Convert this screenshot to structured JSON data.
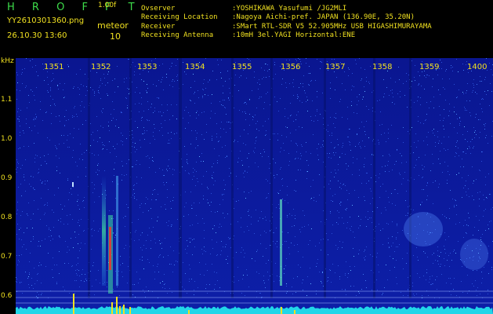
{
  "header": {
    "brand": "H R O F F T",
    "version": "1.00f",
    "filename": "YY2610301360.png",
    "meteor_label": "meteor",
    "timestamp": "26.10.30 13:60",
    "meteor_count": "10",
    "info": [
      {
        "key": "Ovserver",
        "value": ":YOSHIKAWA Yasufumi /JG2MLI"
      },
      {
        "key": "Receiving Location",
        "value": ":Nagoya Aichi-pref. JAPAN (136.90E, 35.20N)"
      },
      {
        "key": "Receiver",
        "value": ":SMart RTL-SDR V5 52.905MHz USB HIGASHIMURAYAMA"
      },
      {
        "key": "Receiving Antenna",
        "value": ":10mH 3el.YAGI Horizontal:ENE"
      }
    ]
  },
  "axis": {
    "unit": "kHz",
    "y_ticks": [
      {
        "label": "1.1",
        "value": 1.1
      },
      {
        "label": "1.0",
        "value": 1.0
      },
      {
        "label": "0.9",
        "value": 0.9
      },
      {
        "label": "0.8",
        "value": 0.8
      },
      {
        "label": "0.7",
        "value": 0.7
      },
      {
        "label": "0.6",
        "value": 0.6
      }
    ],
    "x_ticks": [
      "1351",
      "1352",
      "1353",
      "1354",
      "1355",
      "1356",
      "1357",
      "1358",
      "1359",
      "1400"
    ]
  },
  "colors": {
    "background": "#0b1a9a",
    "text": "#f0e020",
    "brand": "#3ddc4a",
    "baseline": "#21d6e8",
    "echo_hot": "#ff3020"
  }
}
